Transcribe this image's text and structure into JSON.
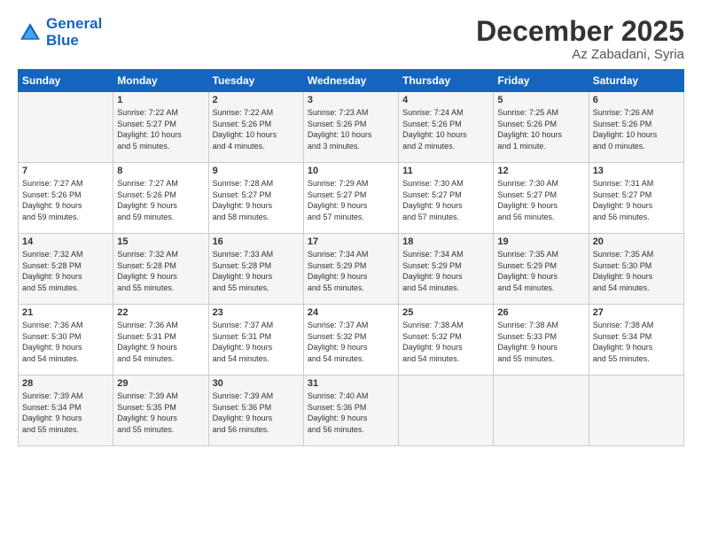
{
  "header": {
    "logo_line1": "General",
    "logo_line2": "Blue",
    "month": "December 2025",
    "location": "Az Zabadani, Syria"
  },
  "days_of_week": [
    "Sunday",
    "Monday",
    "Tuesday",
    "Wednesday",
    "Thursday",
    "Friday",
    "Saturday"
  ],
  "weeks": [
    [
      {
        "day": "",
        "content": ""
      },
      {
        "day": "1",
        "content": "Sunrise: 7:22 AM\nSunset: 5:27 PM\nDaylight: 10 hours\nand 5 minutes."
      },
      {
        "day": "2",
        "content": "Sunrise: 7:22 AM\nSunset: 5:26 PM\nDaylight: 10 hours\nand 4 minutes."
      },
      {
        "day": "3",
        "content": "Sunrise: 7:23 AM\nSunset: 5:26 PM\nDaylight: 10 hours\nand 3 minutes."
      },
      {
        "day": "4",
        "content": "Sunrise: 7:24 AM\nSunset: 5:26 PM\nDaylight: 10 hours\nand 2 minutes."
      },
      {
        "day": "5",
        "content": "Sunrise: 7:25 AM\nSunset: 5:26 PM\nDaylight: 10 hours\nand 1 minute."
      },
      {
        "day": "6",
        "content": "Sunrise: 7:26 AM\nSunset: 5:26 PM\nDaylight: 10 hours\nand 0 minutes."
      }
    ],
    [
      {
        "day": "7",
        "content": "Sunrise: 7:27 AM\nSunset: 5:26 PM\nDaylight: 9 hours\nand 59 minutes."
      },
      {
        "day": "8",
        "content": "Sunrise: 7:27 AM\nSunset: 5:26 PM\nDaylight: 9 hours\nand 59 minutes."
      },
      {
        "day": "9",
        "content": "Sunrise: 7:28 AM\nSunset: 5:27 PM\nDaylight: 9 hours\nand 58 minutes."
      },
      {
        "day": "10",
        "content": "Sunrise: 7:29 AM\nSunset: 5:27 PM\nDaylight: 9 hours\nand 57 minutes."
      },
      {
        "day": "11",
        "content": "Sunrise: 7:30 AM\nSunset: 5:27 PM\nDaylight: 9 hours\nand 57 minutes."
      },
      {
        "day": "12",
        "content": "Sunrise: 7:30 AM\nSunset: 5:27 PM\nDaylight: 9 hours\nand 56 minutes."
      },
      {
        "day": "13",
        "content": "Sunrise: 7:31 AM\nSunset: 5:27 PM\nDaylight: 9 hours\nand 56 minutes."
      }
    ],
    [
      {
        "day": "14",
        "content": "Sunrise: 7:32 AM\nSunset: 5:28 PM\nDaylight: 9 hours\nand 55 minutes."
      },
      {
        "day": "15",
        "content": "Sunrise: 7:32 AM\nSunset: 5:28 PM\nDaylight: 9 hours\nand 55 minutes."
      },
      {
        "day": "16",
        "content": "Sunrise: 7:33 AM\nSunset: 5:28 PM\nDaylight: 9 hours\nand 55 minutes."
      },
      {
        "day": "17",
        "content": "Sunrise: 7:34 AM\nSunset: 5:29 PM\nDaylight: 9 hours\nand 55 minutes."
      },
      {
        "day": "18",
        "content": "Sunrise: 7:34 AM\nSunset: 5:29 PM\nDaylight: 9 hours\nand 54 minutes."
      },
      {
        "day": "19",
        "content": "Sunrise: 7:35 AM\nSunset: 5:29 PM\nDaylight: 9 hours\nand 54 minutes."
      },
      {
        "day": "20",
        "content": "Sunrise: 7:35 AM\nSunset: 5:30 PM\nDaylight: 9 hours\nand 54 minutes."
      }
    ],
    [
      {
        "day": "21",
        "content": "Sunrise: 7:36 AM\nSunset: 5:30 PM\nDaylight: 9 hours\nand 54 minutes."
      },
      {
        "day": "22",
        "content": "Sunrise: 7:36 AM\nSunset: 5:31 PM\nDaylight: 9 hours\nand 54 minutes."
      },
      {
        "day": "23",
        "content": "Sunrise: 7:37 AM\nSunset: 5:31 PM\nDaylight: 9 hours\nand 54 minutes."
      },
      {
        "day": "24",
        "content": "Sunrise: 7:37 AM\nSunset: 5:32 PM\nDaylight: 9 hours\nand 54 minutes."
      },
      {
        "day": "25",
        "content": "Sunrise: 7:38 AM\nSunset: 5:32 PM\nDaylight: 9 hours\nand 54 minutes."
      },
      {
        "day": "26",
        "content": "Sunrise: 7:38 AM\nSunset: 5:33 PM\nDaylight: 9 hours\nand 55 minutes."
      },
      {
        "day": "27",
        "content": "Sunrise: 7:38 AM\nSunset: 5:34 PM\nDaylight: 9 hours\nand 55 minutes."
      }
    ],
    [
      {
        "day": "28",
        "content": "Sunrise: 7:39 AM\nSunset: 5:34 PM\nDaylight: 9 hours\nand 55 minutes."
      },
      {
        "day": "29",
        "content": "Sunrise: 7:39 AM\nSunset: 5:35 PM\nDaylight: 9 hours\nand 55 minutes."
      },
      {
        "day": "30",
        "content": "Sunrise: 7:39 AM\nSunset: 5:36 PM\nDaylight: 9 hours\nand 56 minutes."
      },
      {
        "day": "31",
        "content": "Sunrise: 7:40 AM\nSunset: 5:36 PM\nDaylight: 9 hours\nand 56 minutes."
      },
      {
        "day": "",
        "content": ""
      },
      {
        "day": "",
        "content": ""
      },
      {
        "day": "",
        "content": ""
      }
    ]
  ]
}
